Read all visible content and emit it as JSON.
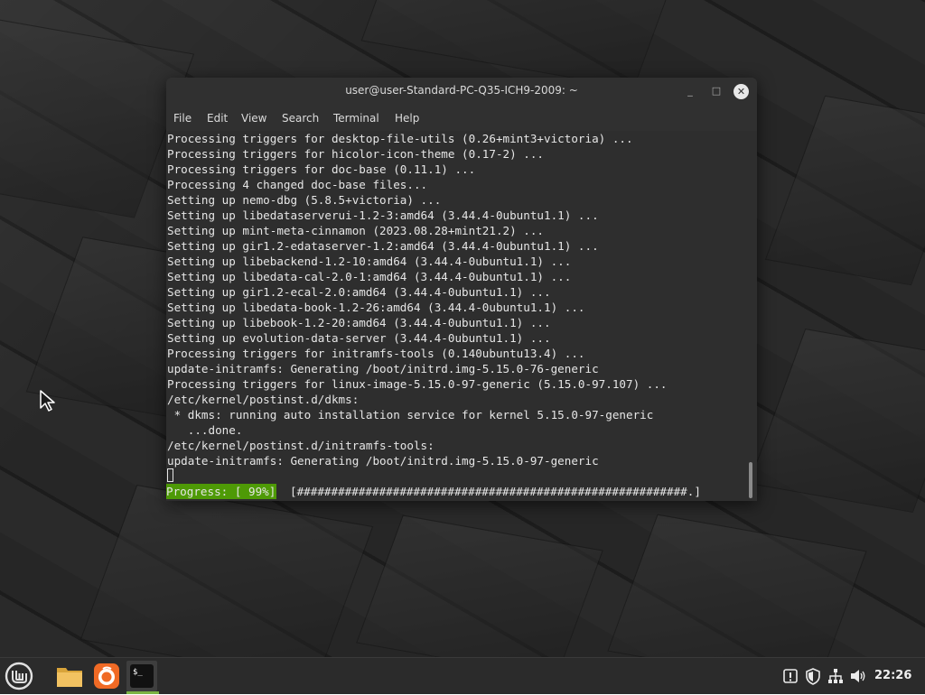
{
  "window": {
    "title": "user@user-Standard-PC-Q35-ICH9-2009: ~",
    "minimize_glyph": "_",
    "maximize_glyph": "□",
    "close_glyph": "✕"
  },
  "menu": {
    "items": [
      "File",
      "Edit",
      "View",
      "Search",
      "Terminal",
      "Help"
    ]
  },
  "terminal": {
    "lines": [
      "Processing triggers for desktop-file-utils (0.26+mint3+victoria) ...",
      "Processing triggers for hicolor-icon-theme (0.17-2) ...",
      "Processing triggers for doc-base (0.11.1) ...",
      "Processing 4 changed doc-base files...",
      "Setting up nemo-dbg (5.8.5+victoria) ...",
      "Setting up libedataserverui-1.2-3:amd64 (3.44.4-0ubuntu1.1) ...",
      "Setting up mint-meta-cinnamon (2023.08.28+mint21.2) ...",
      "Setting up gir1.2-edataserver-1.2:amd64 (3.44.4-0ubuntu1.1) ...",
      "Setting up libebackend-1.2-10:amd64 (3.44.4-0ubuntu1.1) ...",
      "Setting up libedata-cal-2.0-1:amd64 (3.44.4-0ubuntu1.1) ...",
      "Setting up gir1.2-ecal-2.0:amd64 (3.44.4-0ubuntu1.1) ...",
      "Setting up libedata-book-1.2-26:amd64 (3.44.4-0ubuntu1.1) ...",
      "Setting up libebook-1.2-20:amd64 (3.44.4-0ubuntu1.1) ...",
      "Setting up evolution-data-server (3.44.4-0ubuntu1.1) ...",
      "Processing triggers for initramfs-tools (0.140ubuntu13.4) ...",
      "update-initramfs: Generating /boot/initrd.img-5.15.0-76-generic",
      "Processing triggers for linux-image-5.15.0-97-generic (5.15.0-97.107) ...",
      "/etc/kernel/postinst.d/dkms:",
      " * dkms: running auto installation service for kernel 5.15.0-97-generic",
      "   ...done.",
      "/etc/kernel/postinst.d/initramfs-tools:",
      "update-initramfs: Generating /boot/initrd.img-5.15.0-97-generic"
    ],
    "progress_label": "Progress: [ 99%]",
    "progress_bar": "[#########################################################.]",
    "progress_percent": 99
  },
  "taskbar": {
    "clock": "22:26",
    "launchers": [
      "menu",
      "files",
      "firefox",
      "terminal"
    ]
  },
  "colors": {
    "progress_bg": "#4e9a06",
    "terminal_bg": "#2e2e2e",
    "active_indicator": "#7cb342"
  }
}
